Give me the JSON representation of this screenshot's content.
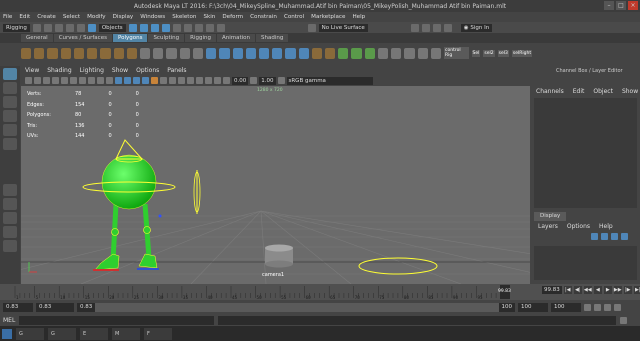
{
  "window": {
    "title": "Autodesk Maya LT 2016: F:\\3ch\\04_MikeySpline_Muhammad.Atif bin Paiman\\05_MikeyPolish_Muhammad Atif bin Paiman.mlt"
  },
  "menubar": [
    "File",
    "Edit",
    "Create",
    "Select",
    "Modify",
    "Display",
    "Windows",
    "Skeleton",
    "Skin",
    "Deform",
    "Constrain",
    "Control",
    "Marketplace",
    "Help"
  ],
  "statusline": {
    "mode": "Rigging",
    "objects_label": "Objects",
    "live_surface": "No Live Surface",
    "sign_in": "Sign In"
  },
  "shelf_tabs": [
    {
      "label": "General",
      "active": false
    },
    {
      "label": "Curves / Surfaces",
      "active": false
    },
    {
      "label": "Polygons",
      "active": true
    },
    {
      "label": "Sculpting",
      "active": false
    },
    {
      "label": "Rigging",
      "active": false
    },
    {
      "label": "Animation",
      "active": false
    },
    {
      "label": "Shading",
      "active": false
    }
  ],
  "shelf_labels": [
    "control Rig",
    "Sel",
    "sel2",
    "sel3",
    "selRight"
  ],
  "panel_menu": [
    "View",
    "Shading",
    "Lighting",
    "Show",
    "Options",
    "Panels"
  ],
  "panel_tools": {
    "exposure": "0.00",
    "gamma": "1.00",
    "color_space": "sRGB gamma"
  },
  "hud": {
    "rows": [
      {
        "label": "Verts:",
        "a": "78",
        "b": "0",
        "c": "0"
      },
      {
        "label": "Edges:",
        "a": "154",
        "b": "0",
        "c": "0"
      },
      {
        "label": "Polygons:",
        "a": "80",
        "b": "0",
        "c": "0"
      },
      {
        "label": "Tris:",
        "a": "136",
        "b": "0",
        "c": "0"
      },
      {
        "label": "UVs:",
        "a": "144",
        "b": "0",
        "c": "0"
      }
    ],
    "cam_label": "1280 x 720"
  },
  "scene": {
    "camera_label": "camera1",
    "colors": {
      "body": "#1fd81f",
      "outline": "#ffff33",
      "leg": "#2fcf2f",
      "floor": "#7a7a7a"
    }
  },
  "right_panel": {
    "tabs": [
      "Channel Box / Layer Editor"
    ],
    "menu": [
      "Channels",
      "Edit",
      "Object",
      "Show"
    ],
    "display_tab": "Display",
    "layer_menu": [
      "Layers",
      "Options",
      "Help"
    ]
  },
  "timeline": {
    "ticks": [
      "1",
      "5",
      "10",
      "15",
      "20",
      "25",
      "30",
      "35",
      "40",
      "45",
      "50",
      "55",
      "60",
      "65",
      "70",
      "75",
      "80",
      "85",
      "90",
      "95"
    ],
    "current_frame": "99.83",
    "end_value": "99.83"
  },
  "range": {
    "start": "0.83",
    "start2": "0.83",
    "slider_start": "0.83",
    "slider_end": "100",
    "end": "100",
    "end2": "100"
  },
  "cmdline": {
    "label": "MEL"
  },
  "taskbar": [
    "G",
    "G",
    "E",
    "M",
    "F"
  ]
}
